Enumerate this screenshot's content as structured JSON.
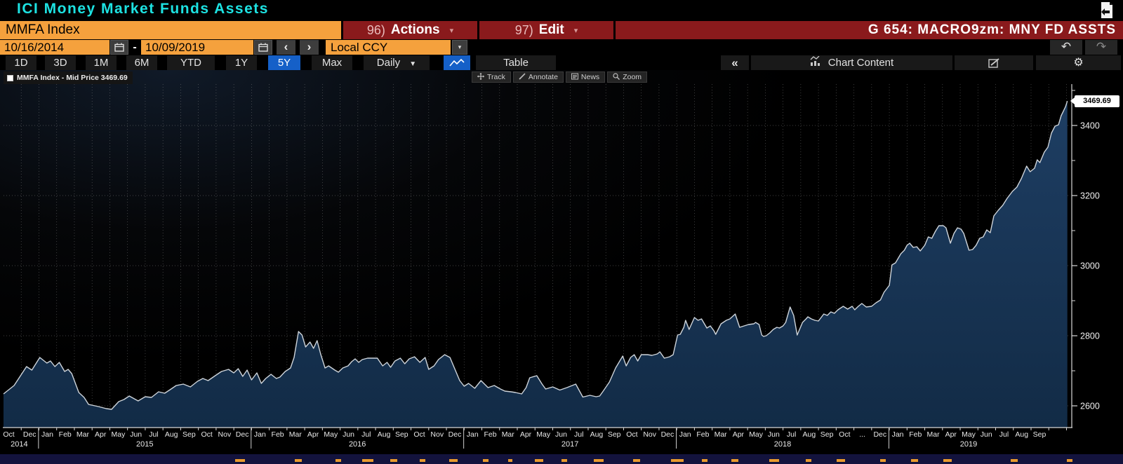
{
  "title_bar": {
    "title": "ICI Money Market Funds Assets"
  },
  "security_bar": {
    "ticker_field": "MMFA Index",
    "actions_number": "96)",
    "actions_label": "Actions",
    "edit_number": "97)",
    "edit_label": "Edit",
    "chart_id": "G 654: MACRO9zm: MNY FD ASSTS"
  },
  "range_bar": {
    "start_date": "10/16/2014",
    "separator": "-",
    "end_date": "10/09/2019",
    "prev": "‹",
    "next": "›",
    "currency": "Local CCY"
  },
  "toolbar": {
    "periods": [
      "1D",
      "3D",
      "1M",
      "6M",
      "YTD",
      "1Y",
      "5Y",
      "Max"
    ],
    "selected_period": "5Y",
    "frequency": "Daily",
    "table_label": "Table",
    "collapse_label": "«",
    "chart_content_label": "Chart Content"
  },
  "chart_tools": {
    "track": "Track",
    "annotate": "Annotate",
    "news": "News",
    "zoom": "Zoom"
  },
  "legend": {
    "label": "MMFA Index - Mid Price 3469.69"
  },
  "last_price": "3469.69",
  "colors": {
    "title_cyan": "#1de2e2",
    "field_orange": "#f5a13d",
    "bar_red": "#8a1a1c",
    "selected_blue": "#1560c8",
    "area_fill_top": "#1e3e63",
    "area_fill_bottom": "#122b46",
    "price_line": "#ced4da"
  },
  "chart_data": {
    "type": "area",
    "title": "ICI Money Market Funds Assets",
    "series_name": "MMFA Index - Mid Price",
    "x_start": "10/16/2014",
    "x_end": "10/09/2019",
    "x_unit": "months_since_start",
    "x_range": [
      0,
      60.1
    ],
    "ylim": [
      2538,
      3518
    ],
    "y_ticks": [
      2600,
      2800,
      3000,
      3200,
      3400
    ],
    "y_minor_ticks": [
      2700,
      2900,
      3100,
      3300,
      3500
    ],
    "grid": true,
    "legend_position": "top-left",
    "last_value": 3469.69,
    "x_axis": {
      "years": [
        {
          "year": "2014",
          "months": [
            "Oct",
            "Dec"
          ]
        },
        {
          "year": "2015",
          "months": [
            "Jan",
            "Feb",
            "Mar",
            "Apr",
            "May",
            "Jun",
            "Jul",
            "Aug",
            "Sep",
            "Oct",
            "Nov",
            "Dec"
          ]
        },
        {
          "year": "2016",
          "months": [
            "Jan",
            "Feb",
            "Mar",
            "Apr",
            "May",
            "Jun",
            "Jul",
            "Aug",
            "Sep",
            "Oct",
            "Nov",
            "Dec"
          ]
        },
        {
          "year": "2017",
          "months": [
            "Jan",
            "Feb",
            "Mar",
            "Apr",
            "May",
            "Jun",
            "Jul",
            "Aug",
            "Sep",
            "Oct",
            "Nov",
            "Dec"
          ]
        },
        {
          "year": "2018",
          "months": [
            "Jan",
            "Feb",
            "Mar",
            "Apr",
            "May",
            "Jun",
            "Jul",
            "Aug",
            "Sep",
            "Oct",
            "...",
            "Dec"
          ]
        },
        {
          "year": "2019",
          "months": [
            "Jan",
            "Feb",
            "Mar",
            "Apr",
            "May",
            "Jun",
            "Jul",
            "Aug",
            "Sep"
          ]
        }
      ]
    },
    "points": [
      [
        0,
        2634
      ],
      [
        0.6,
        2658
      ],
      [
        1.3,
        2712
      ],
      [
        1.6,
        2702
      ],
      [
        2.05,
        2738
      ],
      [
        2.45,
        2722
      ],
      [
        2.65,
        2728
      ],
      [
        2.9,
        2712
      ],
      [
        3.15,
        2724
      ],
      [
        3.45,
        2698
      ],
      [
        3.65,
        2704
      ],
      [
        3.85,
        2692
      ],
      [
        4.25,
        2638
      ],
      [
        4.55,
        2624
      ],
      [
        4.8,
        2604
      ],
      [
        5.35,
        2598
      ],
      [
        5.8,
        2592
      ],
      [
        6.1,
        2590
      ],
      [
        6.5,
        2612
      ],
      [
        6.8,
        2618
      ],
      [
        7.1,
        2628
      ],
      [
        7.6,
        2614
      ],
      [
        8,
        2626
      ],
      [
        8.35,
        2624
      ],
      [
        8.75,
        2640
      ],
      [
        9.1,
        2636
      ],
      [
        9.4,
        2646
      ],
      [
        9.75,
        2658
      ],
      [
        10.15,
        2662
      ],
      [
        10.55,
        2654
      ],
      [
        10.95,
        2670
      ],
      [
        11.25,
        2678
      ],
      [
        11.55,
        2672
      ],
      [
        11.95,
        2686
      ],
      [
        12.3,
        2698
      ],
      [
        12.7,
        2704
      ],
      [
        13,
        2694
      ],
      [
        13.25,
        2706
      ],
      [
        13.5,
        2684
      ],
      [
        13.75,
        2702
      ],
      [
        14,
        2674
      ],
      [
        14.3,
        2694
      ],
      [
        14.55,
        2664
      ],
      [
        14.8,
        2678
      ],
      [
        15.1,
        2690
      ],
      [
        15.4,
        2678
      ],
      [
        15.6,
        2682
      ],
      [
        15.9,
        2698
      ],
      [
        16.2,
        2708
      ],
      [
        16.4,
        2738
      ],
      [
        16.65,
        2812
      ],
      [
        16.85,
        2802
      ],
      [
        17.05,
        2768
      ],
      [
        17.3,
        2782
      ],
      [
        17.5,
        2764
      ],
      [
        17.7,
        2786
      ],
      [
        17.9,
        2748
      ],
      [
        18.15,
        2708
      ],
      [
        18.35,
        2714
      ],
      [
        18.7,
        2702
      ],
      [
        18.9,
        2696
      ],
      [
        19.15,
        2708
      ],
      [
        19.45,
        2714
      ],
      [
        19.65,
        2726
      ],
      [
        19.85,
        2734
      ],
      [
        20.05,
        2724
      ],
      [
        20.25,
        2732
      ],
      [
        20.55,
        2736
      ],
      [
        21.1,
        2736
      ],
      [
        21.4,
        2714
      ],
      [
        21.65,
        2724
      ],
      [
        21.85,
        2710
      ],
      [
        22.1,
        2728
      ],
      [
        22.4,
        2736
      ],
      [
        22.65,
        2720
      ],
      [
        22.9,
        2734
      ],
      [
        23.2,
        2740
      ],
      [
        23.5,
        2724
      ],
      [
        23.8,
        2738
      ],
      [
        24,
        2704
      ],
      [
        24.3,
        2714
      ],
      [
        24.55,
        2732
      ],
      [
        24.9,
        2746
      ],
      [
        25.2,
        2738
      ],
      [
        25.45,
        2708
      ],
      [
        25.75,
        2672
      ],
      [
        26,
        2656
      ],
      [
        26.25,
        2664
      ],
      [
        26.6,
        2650
      ],
      [
        26.95,
        2672
      ],
      [
        27.35,
        2652
      ],
      [
        27.7,
        2658
      ],
      [
        28.05,
        2648
      ],
      [
        28.3,
        2642
      ],
      [
        28.65,
        2640
      ],
      [
        28.9,
        2638
      ],
      [
        29.25,
        2634
      ],
      [
        29.5,
        2652
      ],
      [
        29.7,
        2680
      ],
      [
        30.1,
        2686
      ],
      [
        30.4,
        2662
      ],
      [
        30.6,
        2648
      ],
      [
        31,
        2654
      ],
      [
        31.4,
        2645
      ],
      [
        31.8,
        2652
      ],
      [
        32.3,
        2662
      ],
      [
        32.7,
        2625
      ],
      [
        33.1,
        2630
      ],
      [
        33.45,
        2626
      ],
      [
        33.65,
        2628
      ],
      [
        33.85,
        2642
      ],
      [
        34.2,
        2668
      ],
      [
        34.55,
        2708
      ],
      [
        34.95,
        2742
      ],
      [
        35.15,
        2714
      ],
      [
        35.4,
        2738
      ],
      [
        35.6,
        2746
      ],
      [
        35.8,
        2728
      ],
      [
        36,
        2746
      ],
      [
        36.35,
        2746
      ],
      [
        36.6,
        2744
      ],
      [
        36.9,
        2748
      ],
      [
        37.05,
        2754
      ],
      [
        37.3,
        2736
      ],
      [
        37.6,
        2740
      ],
      [
        37.8,
        2746
      ],
      [
        38.05,
        2802
      ],
      [
        38.2,
        2804
      ],
      [
        38.4,
        2824
      ],
      [
        38.5,
        2844
      ],
      [
        38.7,
        2818
      ],
      [
        39,
        2852
      ],
      [
        39.2,
        2844
      ],
      [
        39.4,
        2848
      ],
      [
        39.7,
        2822
      ],
      [
        39.9,
        2828
      ],
      [
        40.1,
        2814
      ],
      [
        40.2,
        2804
      ],
      [
        40.5,
        2834
      ],
      [
        40.8,
        2844
      ],
      [
        41,
        2848
      ],
      [
        41.3,
        2862
      ],
      [
        41.55,
        2824
      ],
      [
        41.8,
        2828
      ],
      [
        42.05,
        2832
      ],
      [
        42.35,
        2834
      ],
      [
        42.45,
        2838
      ],
      [
        42.65,
        2832
      ],
      [
        42.8,
        2802
      ],
      [
        42.9,
        2798
      ],
      [
        43.05,
        2800
      ],
      [
        43.25,
        2808
      ],
      [
        43.45,
        2818
      ],
      [
        43.65,
        2824
      ],
      [
        43.8,
        2822
      ],
      [
        44,
        2828
      ],
      [
        44.15,
        2838
      ],
      [
        44.4,
        2882
      ],
      [
        44.6,
        2858
      ],
      [
        44.8,
        2802
      ],
      [
        45.1,
        2838
      ],
      [
        45.3,
        2848
      ],
      [
        45.4,
        2854
      ],
      [
        45.6,
        2848
      ],
      [
        45.8,
        2844
      ],
      [
        46,
        2842
      ],
      [
        46.3,
        2862
      ],
      [
        46.5,
        2858
      ],
      [
        46.7,
        2868
      ],
      [
        46.9,
        2864
      ],
      [
        47.1,
        2874
      ],
      [
        47.4,
        2884
      ],
      [
        47.65,
        2876
      ],
      [
        47.9,
        2884
      ],
      [
        48.05,
        2874
      ],
      [
        48.25,
        2884
      ],
      [
        48.45,
        2892
      ],
      [
        48.7,
        2882
      ],
      [
        49,
        2884
      ],
      [
        49.25,
        2894
      ],
      [
        49.5,
        2902
      ],
      [
        49.7,
        2924
      ],
      [
        50,
        2944
      ],
      [
        50.15,
        3002
      ],
      [
        50.35,
        3008
      ],
      [
        50.65,
        3034
      ],
      [
        50.85,
        3044
      ],
      [
        51,
        3058
      ],
      [
        51.15,
        3064
      ],
      [
        51.35,
        3052
      ],
      [
        51.55,
        3054
      ],
      [
        51.75,
        3042
      ],
      [
        52,
        3058
      ],
      [
        52.2,
        3082
      ],
      [
        52.4,
        3078
      ],
      [
        52.6,
        3098
      ],
      [
        52.8,
        3114
      ],
      [
        53.05,
        3114
      ],
      [
        53.2,
        3108
      ],
      [
        53.45,
        3064
      ],
      [
        53.65,
        3092
      ],
      [
        53.85,
        3108
      ],
      [
        54.05,
        3104
      ],
      [
        54.2,
        3092
      ],
      [
        54.5,
        3044
      ],
      [
        54.7,
        3046
      ],
      [
        54.9,
        3058
      ],
      [
        55.1,
        3078
      ],
      [
        55.3,
        3082
      ],
      [
        55.5,
        3102
      ],
      [
        55.7,
        3094
      ],
      [
        55.9,
        3142
      ],
      [
        56.15,
        3158
      ],
      [
        56.4,
        3172
      ],
      [
        56.65,
        3192
      ],
      [
        56.95,
        3212
      ],
      [
        57.2,
        3224
      ],
      [
        57.45,
        3248
      ],
      [
        57.75,
        3284
      ],
      [
        57.95,
        3268
      ],
      [
        58.2,
        3278
      ],
      [
        58.35,
        3302
      ],
      [
        58.5,
        3294
      ],
      [
        58.75,
        3324
      ],
      [
        58.95,
        3338
      ],
      [
        59.15,
        3378
      ],
      [
        59.35,
        3398
      ],
      [
        59.55,
        3402
      ],
      [
        59.7,
        3428
      ],
      [
        59.8,
        3438
      ],
      [
        59.95,
        3454
      ],
      [
        60.05,
        3469.69
      ]
    ]
  }
}
